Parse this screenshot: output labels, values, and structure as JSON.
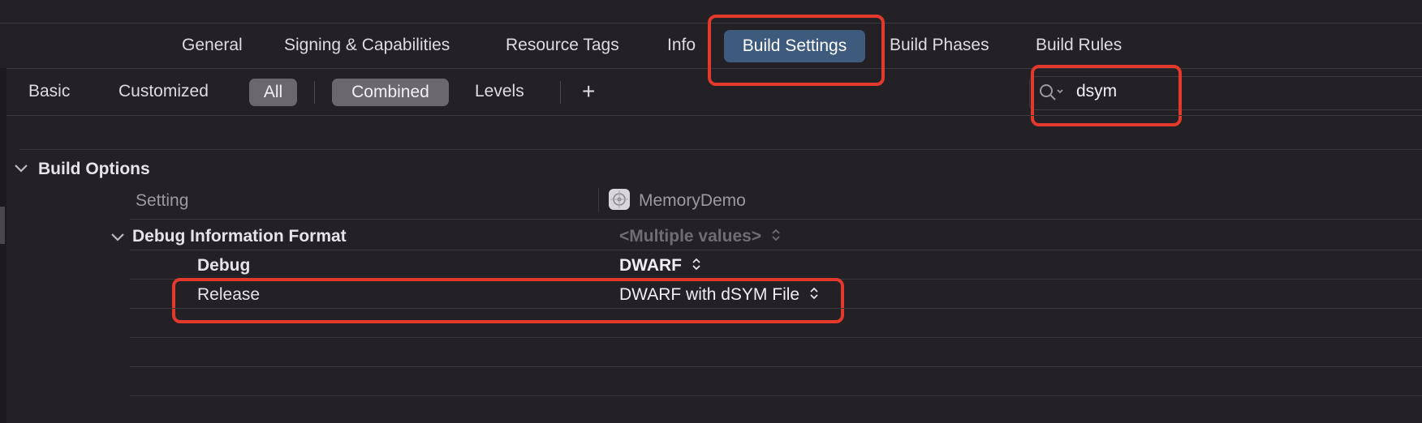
{
  "tabs": [
    "General",
    "Signing & Capabilities",
    "Resource Tags",
    "Info",
    "Build Settings",
    "Build Phases",
    "Build Rules"
  ],
  "selected_tab": "Build Settings",
  "filters": {
    "basic": "Basic",
    "customized": "Customized",
    "all": "All",
    "combined": "Combined",
    "levels": "Levels",
    "add": "+"
  },
  "search": {
    "value": "dsym"
  },
  "section": {
    "title": "Build Options"
  },
  "columns": {
    "setting": "Setting",
    "target": "MemoryDemo"
  },
  "setting_group": {
    "name": "Debug Information Format",
    "value": "<Multiple values>",
    "rows": [
      {
        "label": "Debug",
        "value": "DWARF"
      },
      {
        "label": "Release",
        "value": "DWARF with dSYM File"
      }
    ]
  },
  "colors": {
    "highlight": "#e2392b",
    "selected_tab": "#3e5a7d",
    "background": "#242126"
  }
}
